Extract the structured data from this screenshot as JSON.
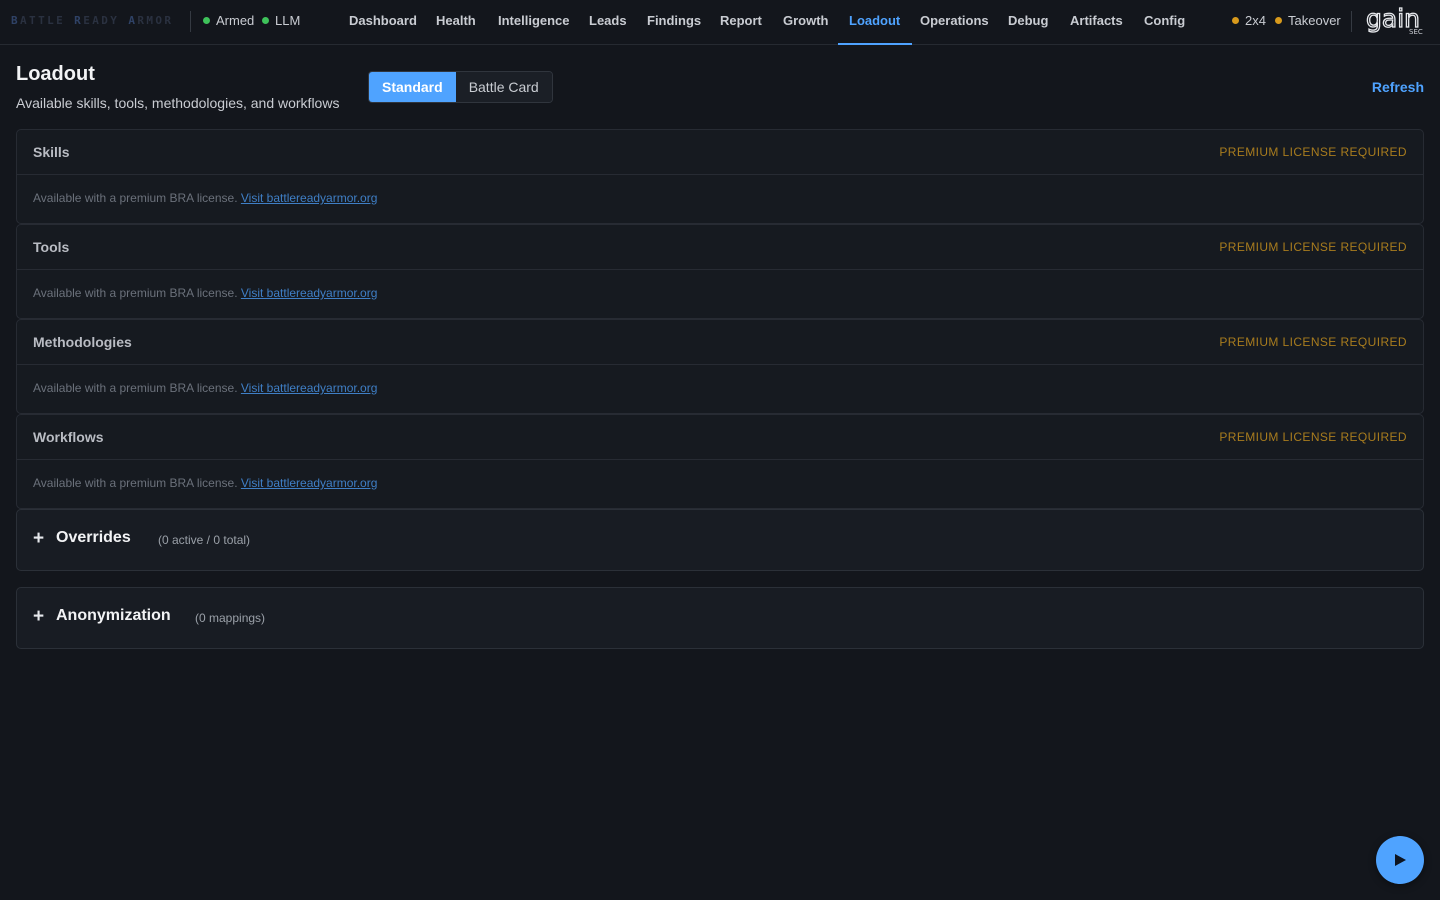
{
  "brand": {
    "text": "BATTLE READY ARMOR"
  },
  "status": {
    "left": [
      {
        "label": "Armed",
        "color": "#3ec25a"
      },
      {
        "label": "LLM",
        "color": "#3ec25a"
      }
    ],
    "right": [
      {
        "label": "2x4",
        "color": "#d89a1c"
      },
      {
        "label": "Takeover",
        "color": "#d89a1c"
      }
    ]
  },
  "nav": {
    "tabs": [
      "Dashboard",
      "Health",
      "Intelligence",
      "Leads",
      "Findings",
      "Report",
      "Growth",
      "Loadout",
      "Operations",
      "Debug",
      "Artifacts",
      "Config"
    ],
    "active": "Loadout"
  },
  "logo": {
    "word": "gain",
    "sub": "SEC"
  },
  "header": {
    "title": "Loadout",
    "subtitle": "Available skills, tools, methodologies, and workflows",
    "segments": [
      "Standard",
      "Battle Card"
    ],
    "active_segment": "Standard",
    "refresh_label": "Refresh"
  },
  "panels": [
    {
      "title": "Skills",
      "badge": "PREMIUM LICENSE REQUIRED",
      "body": "Available with a premium BRA license.",
      "link": "Visit battlereadyarmor.org"
    },
    {
      "title": "Tools",
      "badge": "PREMIUM LICENSE REQUIRED",
      "body": "Available with a premium BRA license.",
      "link": "Visit battlereadyarmor.org"
    },
    {
      "title": "Methodologies",
      "badge": "PREMIUM LICENSE REQUIRED",
      "body": "Available with a premium BRA license.",
      "link": "Visit battlereadyarmor.org"
    },
    {
      "title": "Workflows",
      "badge": "PREMIUM LICENSE REQUIRED",
      "body": "Available with a premium BRA license.",
      "link": "Visit battlereadyarmor.org"
    }
  ],
  "overrides": {
    "icon": "+",
    "title": "Overrides",
    "meta": "(0 active / 0 total)"
  },
  "anonymization": {
    "icon": "+",
    "title": "Anonymization",
    "meta": "(0 mappings)"
  },
  "fab": {
    "icon": "play-icon"
  },
  "colors": {
    "accent": "#4fa3ff",
    "premium": "#a87c1e",
    "bg": "#13161c"
  }
}
